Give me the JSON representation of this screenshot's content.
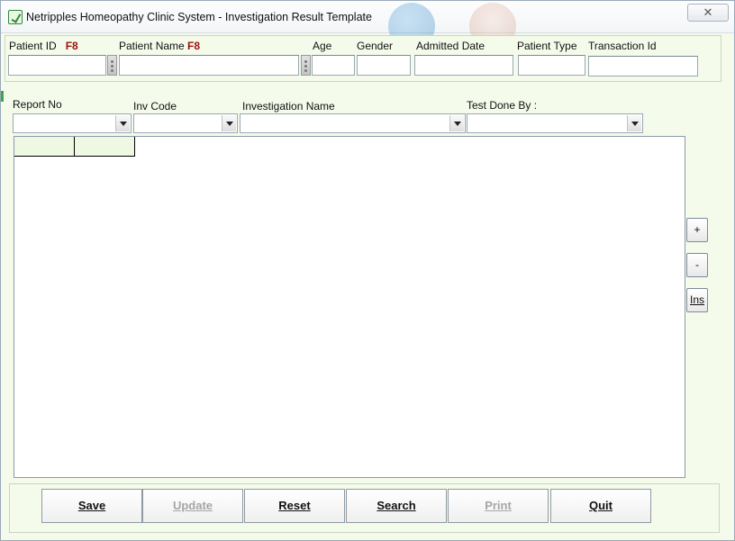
{
  "window": {
    "title": "Netripples Homeopathy Clinic System  - Investigation Result Template",
    "close_glyph": "✕"
  },
  "patient": {
    "patient_id_label": "Patient ID",
    "patient_id_key": "F8",
    "patient_name_label": "Patient Name",
    "patient_name_key": "F8",
    "age_label": "Age",
    "gender_label": "Gender",
    "admitted_date_label": "Admitted Date",
    "patient_type_label": "Patient Type",
    "transaction_id_label": "Transaction Id",
    "patient_id_value": "",
    "patient_name_value": "",
    "age_value": "",
    "gender_value": "",
    "admitted_date_value": "",
    "patient_type_value": "",
    "transaction_id_value": ""
  },
  "investigation": {
    "report_no_label": "Report No",
    "inv_code_label": "Inv Code",
    "investigation_name_label": "Investigation Name",
    "test_done_by_label": "Test Done By :",
    "report_no_value": "",
    "inv_code_value": "",
    "investigation_name_value": "",
    "test_done_by_value": ""
  },
  "grid_tools": {
    "add_label": "+",
    "remove_label": "-",
    "insert_label": "Ins"
  },
  "actions": {
    "save_label": "Save",
    "update_label": "Update",
    "reset_label": "Reset",
    "search_label": "Search",
    "print_label": "Print",
    "quit_label": "Quit"
  },
  "colors": {
    "form_background": "#f4fbea",
    "shortcut_key": "#a01010",
    "disabled_text": "#a6a6a6"
  }
}
